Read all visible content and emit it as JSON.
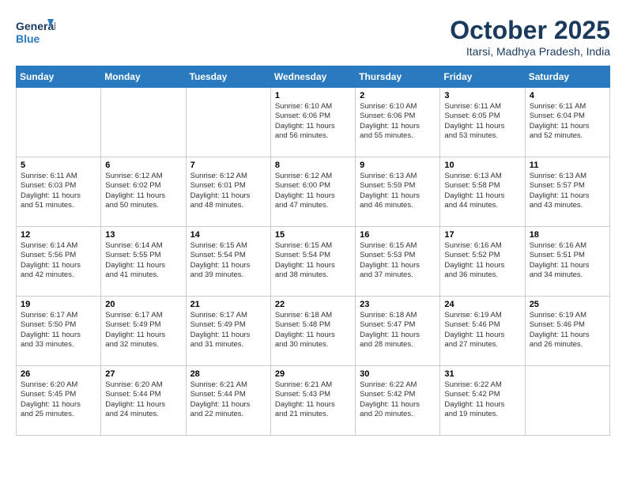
{
  "header": {
    "logo_line1": "General",
    "logo_line2": "Blue",
    "month": "October 2025",
    "location": "Itarsi, Madhya Pradesh, India"
  },
  "days_of_week": [
    "Sunday",
    "Monday",
    "Tuesday",
    "Wednesday",
    "Thursday",
    "Friday",
    "Saturday"
  ],
  "weeks": [
    [
      {
        "day": "",
        "info": ""
      },
      {
        "day": "",
        "info": ""
      },
      {
        "day": "",
        "info": ""
      },
      {
        "day": "1",
        "info": "Sunrise: 6:10 AM\nSunset: 6:06 PM\nDaylight: 11 hours\nand 56 minutes."
      },
      {
        "day": "2",
        "info": "Sunrise: 6:10 AM\nSunset: 6:06 PM\nDaylight: 11 hours\nand 55 minutes."
      },
      {
        "day": "3",
        "info": "Sunrise: 6:11 AM\nSunset: 6:05 PM\nDaylight: 11 hours\nand 53 minutes."
      },
      {
        "day": "4",
        "info": "Sunrise: 6:11 AM\nSunset: 6:04 PM\nDaylight: 11 hours\nand 52 minutes."
      }
    ],
    [
      {
        "day": "5",
        "info": "Sunrise: 6:11 AM\nSunset: 6:03 PM\nDaylight: 11 hours\nand 51 minutes."
      },
      {
        "day": "6",
        "info": "Sunrise: 6:12 AM\nSunset: 6:02 PM\nDaylight: 11 hours\nand 50 minutes."
      },
      {
        "day": "7",
        "info": "Sunrise: 6:12 AM\nSunset: 6:01 PM\nDaylight: 11 hours\nand 48 minutes."
      },
      {
        "day": "8",
        "info": "Sunrise: 6:12 AM\nSunset: 6:00 PM\nDaylight: 11 hours\nand 47 minutes."
      },
      {
        "day": "9",
        "info": "Sunrise: 6:13 AM\nSunset: 5:59 PM\nDaylight: 11 hours\nand 46 minutes."
      },
      {
        "day": "10",
        "info": "Sunrise: 6:13 AM\nSunset: 5:58 PM\nDaylight: 11 hours\nand 44 minutes."
      },
      {
        "day": "11",
        "info": "Sunrise: 6:13 AM\nSunset: 5:57 PM\nDaylight: 11 hours\nand 43 minutes."
      }
    ],
    [
      {
        "day": "12",
        "info": "Sunrise: 6:14 AM\nSunset: 5:56 PM\nDaylight: 11 hours\nand 42 minutes."
      },
      {
        "day": "13",
        "info": "Sunrise: 6:14 AM\nSunset: 5:55 PM\nDaylight: 11 hours\nand 41 minutes."
      },
      {
        "day": "14",
        "info": "Sunrise: 6:15 AM\nSunset: 5:54 PM\nDaylight: 11 hours\nand 39 minutes."
      },
      {
        "day": "15",
        "info": "Sunrise: 6:15 AM\nSunset: 5:54 PM\nDaylight: 11 hours\nand 38 minutes."
      },
      {
        "day": "16",
        "info": "Sunrise: 6:15 AM\nSunset: 5:53 PM\nDaylight: 11 hours\nand 37 minutes."
      },
      {
        "day": "17",
        "info": "Sunrise: 6:16 AM\nSunset: 5:52 PM\nDaylight: 11 hours\nand 36 minutes."
      },
      {
        "day": "18",
        "info": "Sunrise: 6:16 AM\nSunset: 5:51 PM\nDaylight: 11 hours\nand 34 minutes."
      }
    ],
    [
      {
        "day": "19",
        "info": "Sunrise: 6:17 AM\nSunset: 5:50 PM\nDaylight: 11 hours\nand 33 minutes."
      },
      {
        "day": "20",
        "info": "Sunrise: 6:17 AM\nSunset: 5:49 PM\nDaylight: 11 hours\nand 32 minutes."
      },
      {
        "day": "21",
        "info": "Sunrise: 6:17 AM\nSunset: 5:49 PM\nDaylight: 11 hours\nand 31 minutes."
      },
      {
        "day": "22",
        "info": "Sunrise: 6:18 AM\nSunset: 5:48 PM\nDaylight: 11 hours\nand 30 minutes."
      },
      {
        "day": "23",
        "info": "Sunrise: 6:18 AM\nSunset: 5:47 PM\nDaylight: 11 hours\nand 28 minutes."
      },
      {
        "day": "24",
        "info": "Sunrise: 6:19 AM\nSunset: 5:46 PM\nDaylight: 11 hours\nand 27 minutes."
      },
      {
        "day": "25",
        "info": "Sunrise: 6:19 AM\nSunset: 5:46 PM\nDaylight: 11 hours\nand 26 minutes."
      }
    ],
    [
      {
        "day": "26",
        "info": "Sunrise: 6:20 AM\nSunset: 5:45 PM\nDaylight: 11 hours\nand 25 minutes."
      },
      {
        "day": "27",
        "info": "Sunrise: 6:20 AM\nSunset: 5:44 PM\nDaylight: 11 hours\nand 24 minutes."
      },
      {
        "day": "28",
        "info": "Sunrise: 6:21 AM\nSunset: 5:44 PM\nDaylight: 11 hours\nand 22 minutes."
      },
      {
        "day": "29",
        "info": "Sunrise: 6:21 AM\nSunset: 5:43 PM\nDaylight: 11 hours\nand 21 minutes."
      },
      {
        "day": "30",
        "info": "Sunrise: 6:22 AM\nSunset: 5:42 PM\nDaylight: 11 hours\nand 20 minutes."
      },
      {
        "day": "31",
        "info": "Sunrise: 6:22 AM\nSunset: 5:42 PM\nDaylight: 11 hours\nand 19 minutes."
      },
      {
        "day": "",
        "info": ""
      }
    ]
  ]
}
